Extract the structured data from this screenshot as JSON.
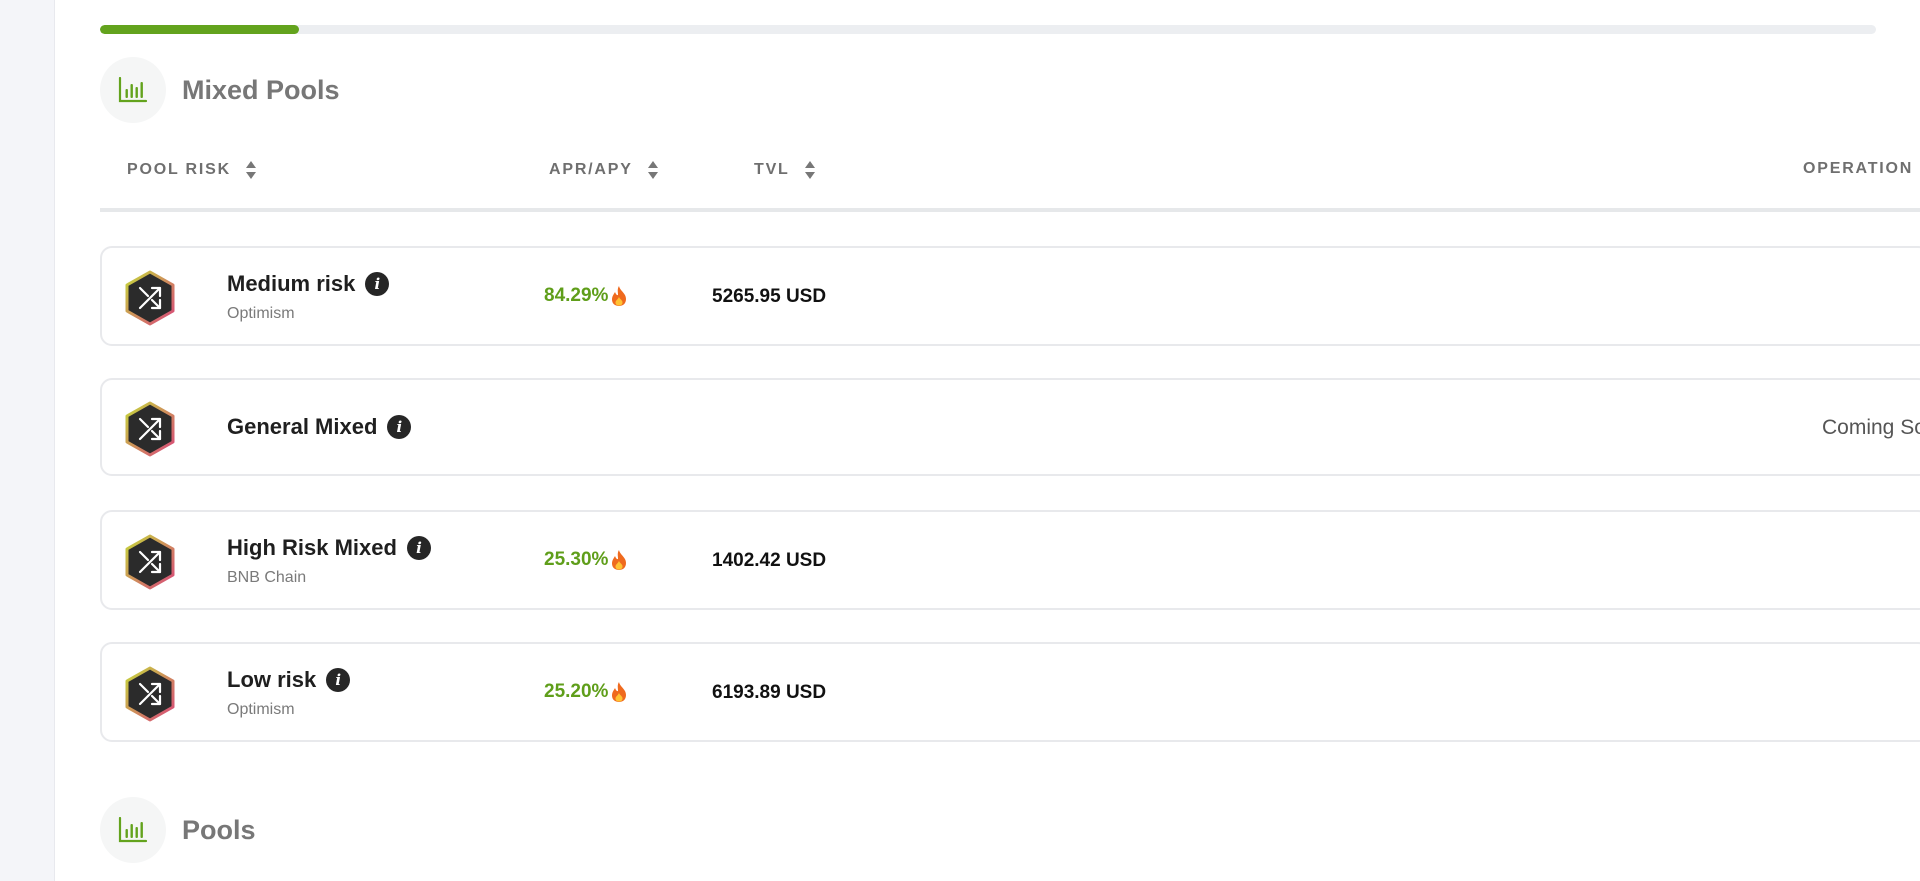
{
  "progress": {
    "percent": 11.2
  },
  "sections": {
    "mixed": {
      "title": "Mixed Pools",
      "icon": "bar-chart-icon"
    },
    "pools": {
      "title": "Pools",
      "icon": "bar-chart-icon"
    }
  },
  "table": {
    "headers": {
      "pool_risk": "POOL RISK",
      "apr_apy": "APR/APY",
      "tvl": "TVL",
      "operation": "OPERATION"
    }
  },
  "rows": [
    {
      "name": "Medium risk",
      "chain": "Optimism",
      "apr": "84.29%",
      "tvl": "5265.95 USD",
      "operation": ""
    },
    {
      "name": "General Mixed",
      "chain": "",
      "apr": "",
      "tvl": "",
      "operation": "Coming Soon"
    },
    {
      "name": "High Risk Mixed",
      "chain": "BNB Chain",
      "apr": "25.30%",
      "tvl": "1402.42 USD",
      "operation": ""
    },
    {
      "name": "Low risk",
      "chain": "Optimism",
      "apr": "25.20%",
      "tvl": "6193.89 USD",
      "operation": ""
    }
  ],
  "colors": {
    "accent": "#63a31d",
    "apr_text": "#5f9e1a",
    "badge_bg": "#2b2b2b",
    "badge_border_start": "#c4d83a",
    "badge_border_end": "#d9467b"
  },
  "icons": {
    "info": "info-icon",
    "fire": "fire-icon",
    "shuffle": "shuffle-icon",
    "sort": "sort-icon"
  }
}
